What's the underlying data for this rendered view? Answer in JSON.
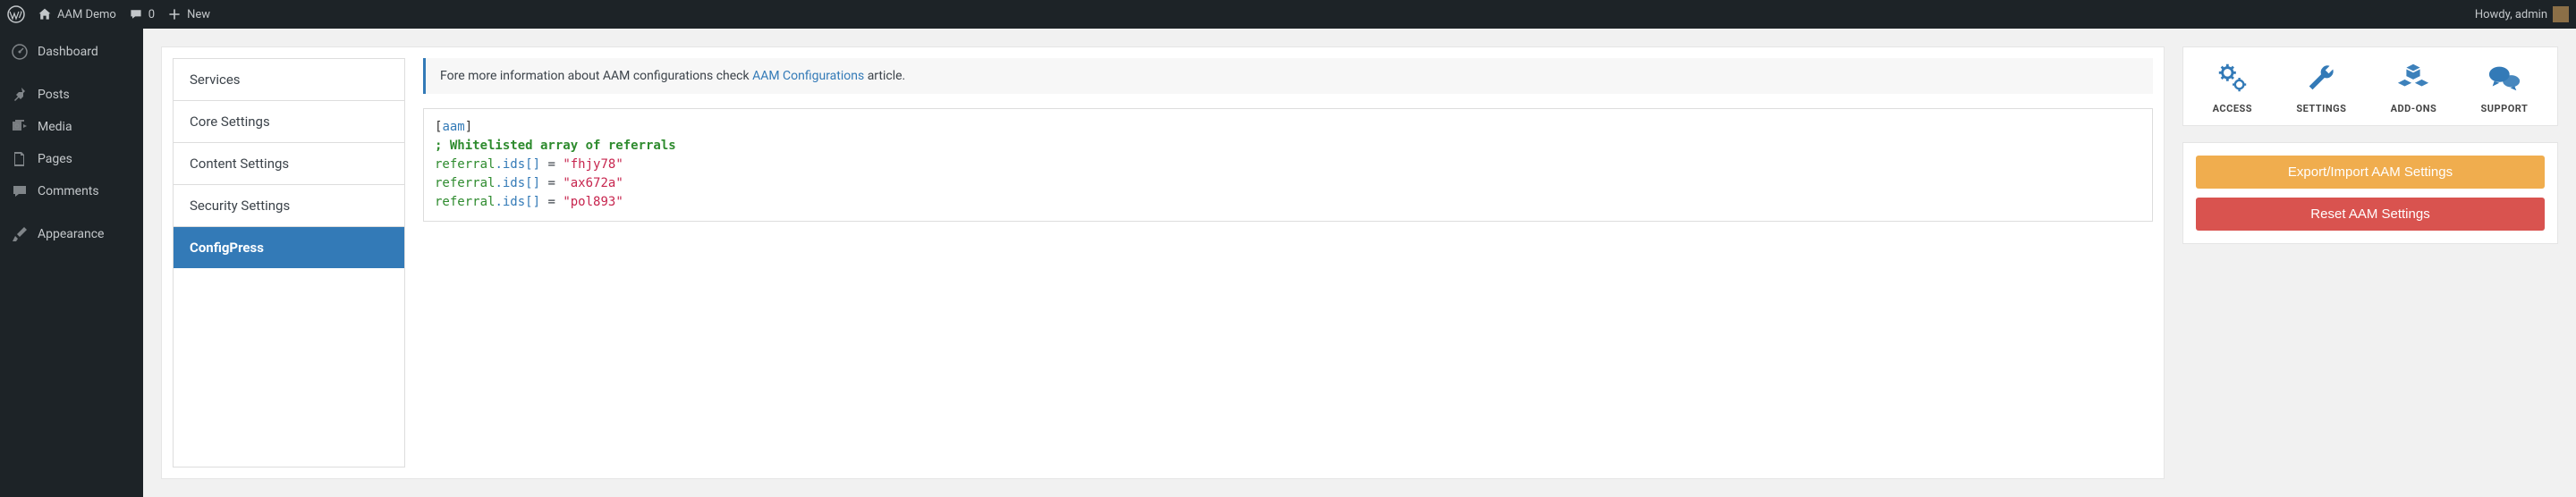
{
  "adminbar": {
    "site_name": "AAM Demo",
    "comments_count": "0",
    "new_label": "New",
    "greeting": "Howdy, admin"
  },
  "sidebar": {
    "items": [
      {
        "label": "Dashboard",
        "icon": "dashboard"
      },
      {
        "label": "Posts",
        "icon": "pin"
      },
      {
        "label": "Media",
        "icon": "media"
      },
      {
        "label": "Pages",
        "icon": "pages"
      },
      {
        "label": "Comments",
        "icon": "comment"
      },
      {
        "label": "Appearance",
        "icon": "brush"
      }
    ]
  },
  "tabs": [
    {
      "label": "Services",
      "active": false
    },
    {
      "label": "Core Settings",
      "active": false
    },
    {
      "label": "Content Settings",
      "active": false
    },
    {
      "label": "Security Settings",
      "active": false
    },
    {
      "label": "ConfigPress",
      "active": true
    }
  ],
  "info": {
    "text_before": "Fore more information about AAM configurations check ",
    "link_text": "AAM Configurations",
    "text_after": " article."
  },
  "code": {
    "section": "aam",
    "comment": "; Whitelisted array of referrals",
    "lines": [
      {
        "key": "referral",
        "prop": ".ids[]",
        "op": " = ",
        "val": "\"fhjy78\""
      },
      {
        "key": "referral",
        "prop": ".ids[]",
        "op": " = ",
        "val": "\"ax672a\""
      },
      {
        "key": "referral",
        "prop": ".ids[]",
        "op": " = ",
        "val": "\"pol893\""
      }
    ]
  },
  "icon_nav": [
    {
      "label": "ACCESS",
      "icon": "gears"
    },
    {
      "label": "SETTINGS",
      "icon": "wrench"
    },
    {
      "label": "ADD-ONS",
      "icon": "cubes"
    },
    {
      "label": "SUPPORT",
      "icon": "chat"
    }
  ],
  "buttons": {
    "export_import": "Export/Import AAM Settings",
    "reset": "Reset AAM Settings"
  }
}
